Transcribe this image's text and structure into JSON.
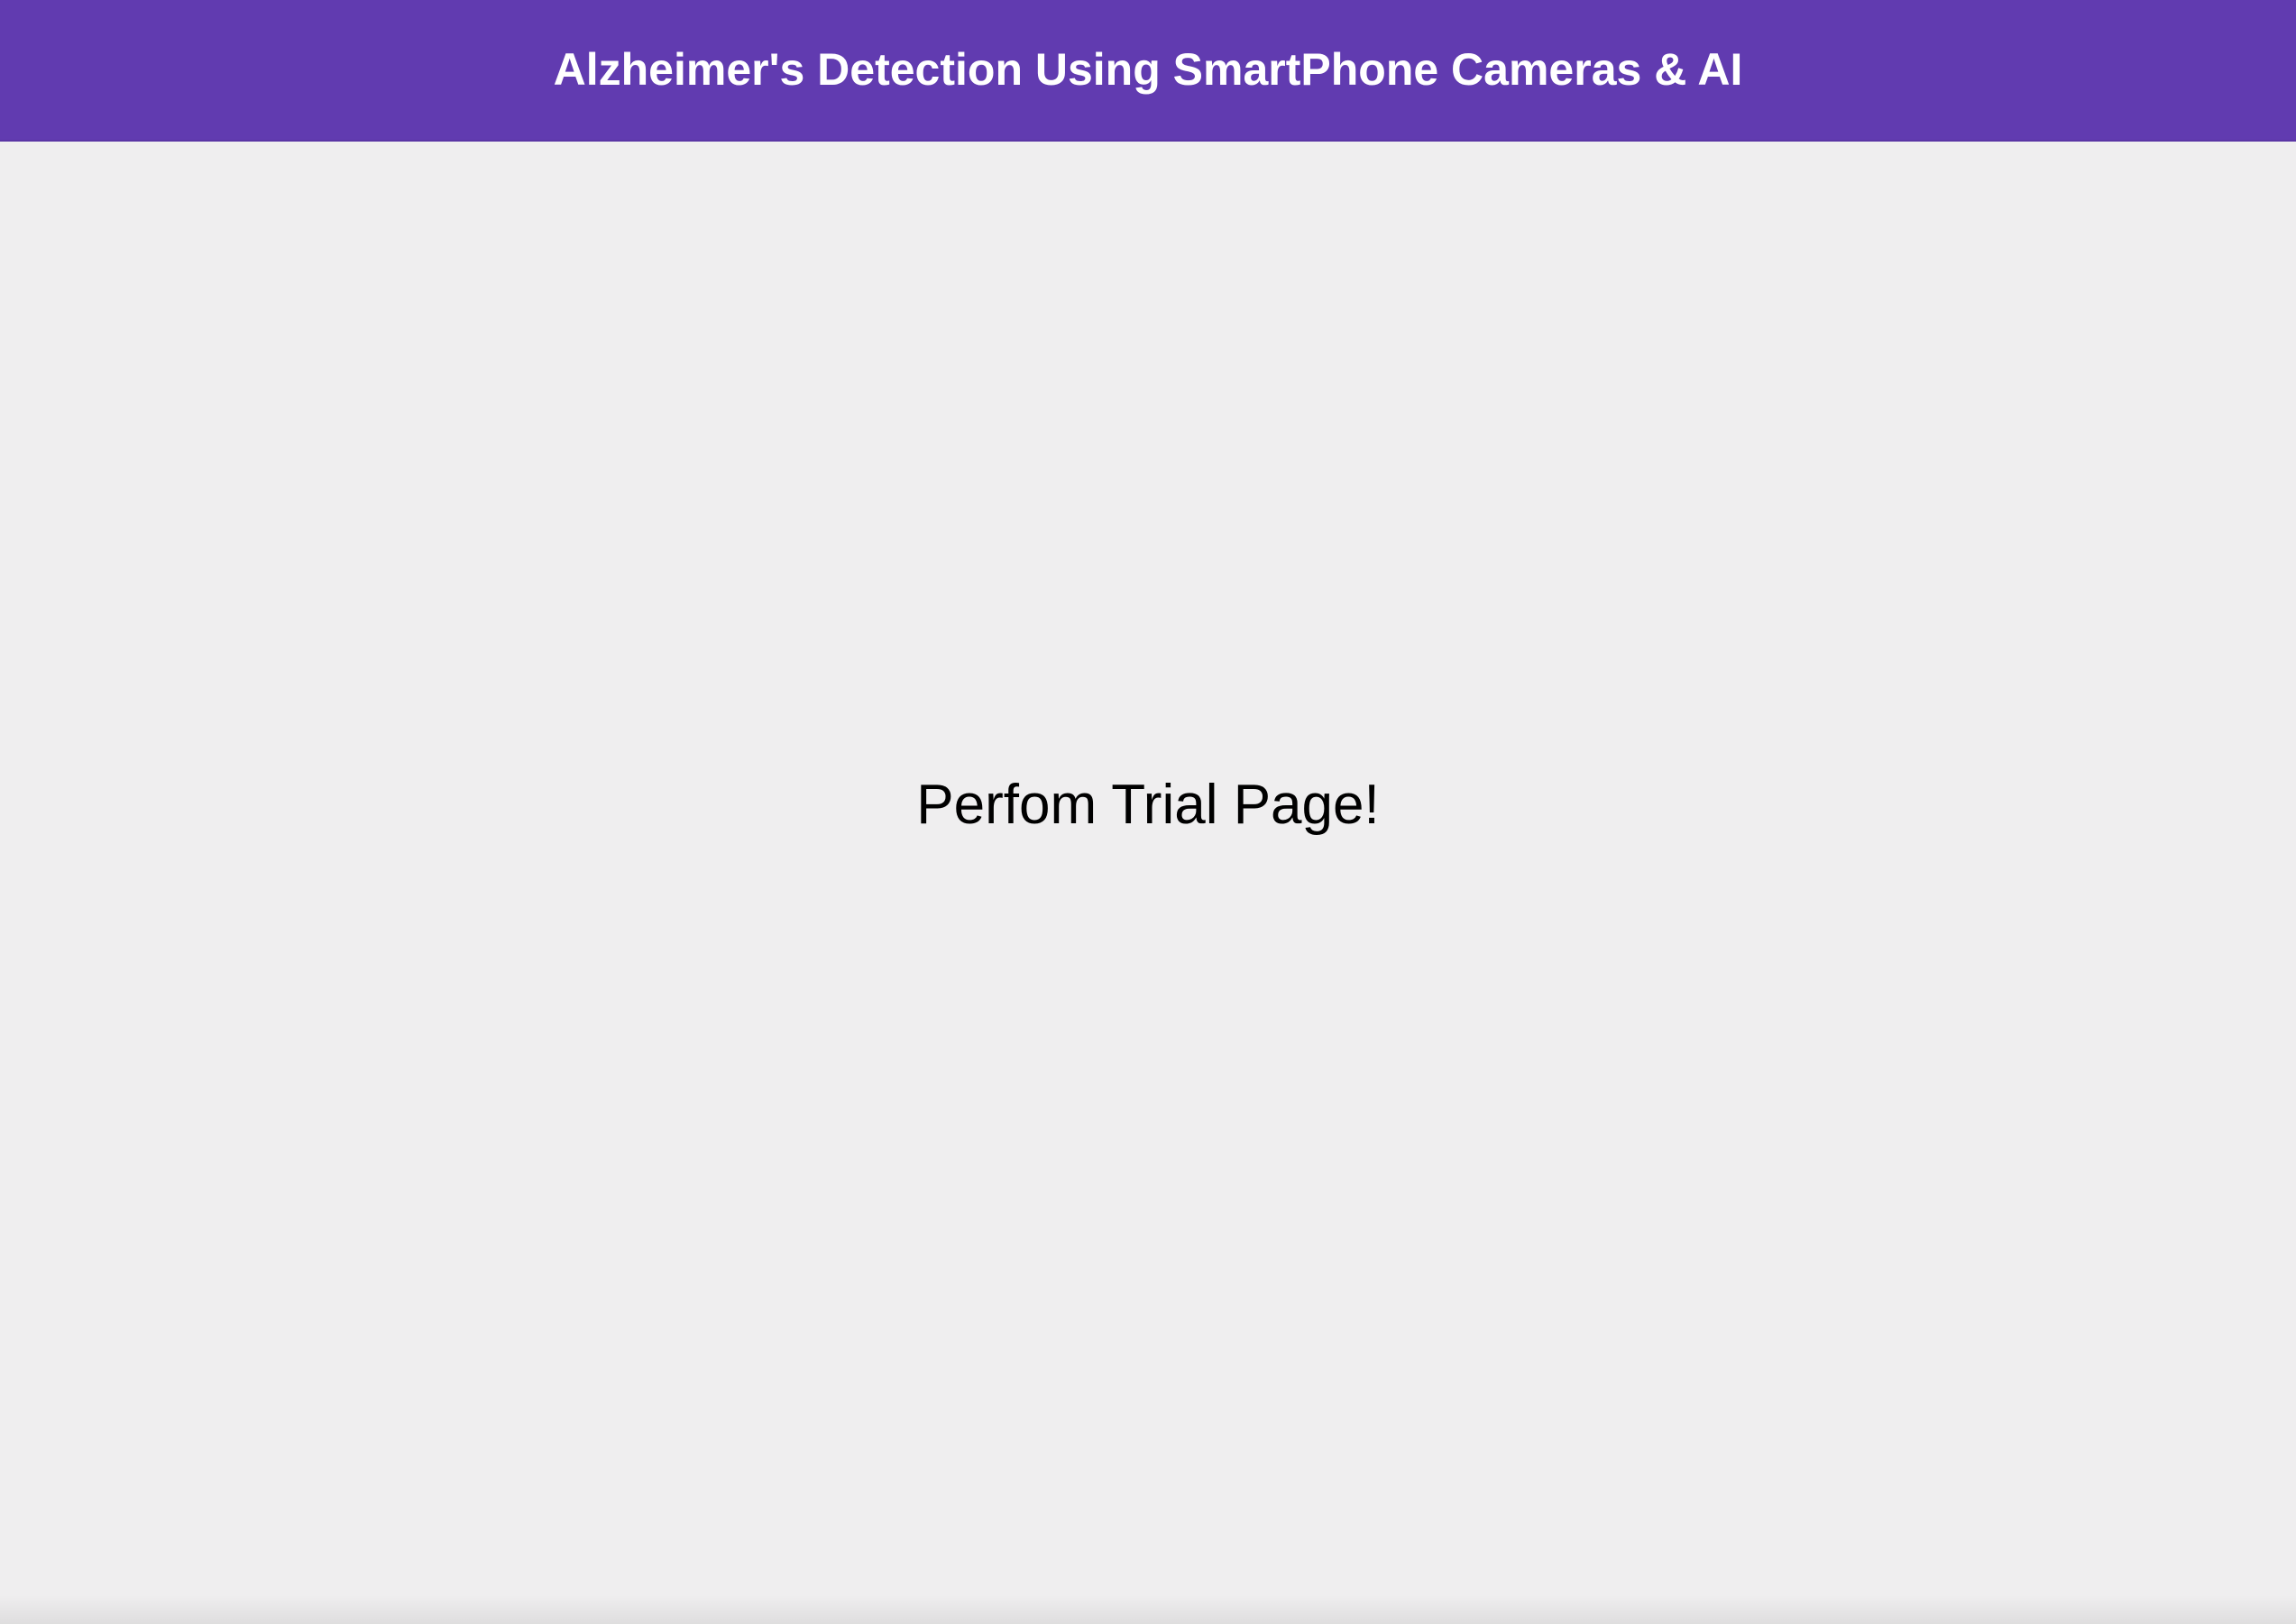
{
  "header": {
    "title": "Alzheimer's Detection Using SmartPhone Cameras & AI"
  },
  "main": {
    "message": "Perfom Trial Page!"
  },
  "colors": {
    "header_background": "#613bb0",
    "page_background": "#efeeef",
    "header_text": "#ffffff",
    "body_text": "#000000"
  }
}
